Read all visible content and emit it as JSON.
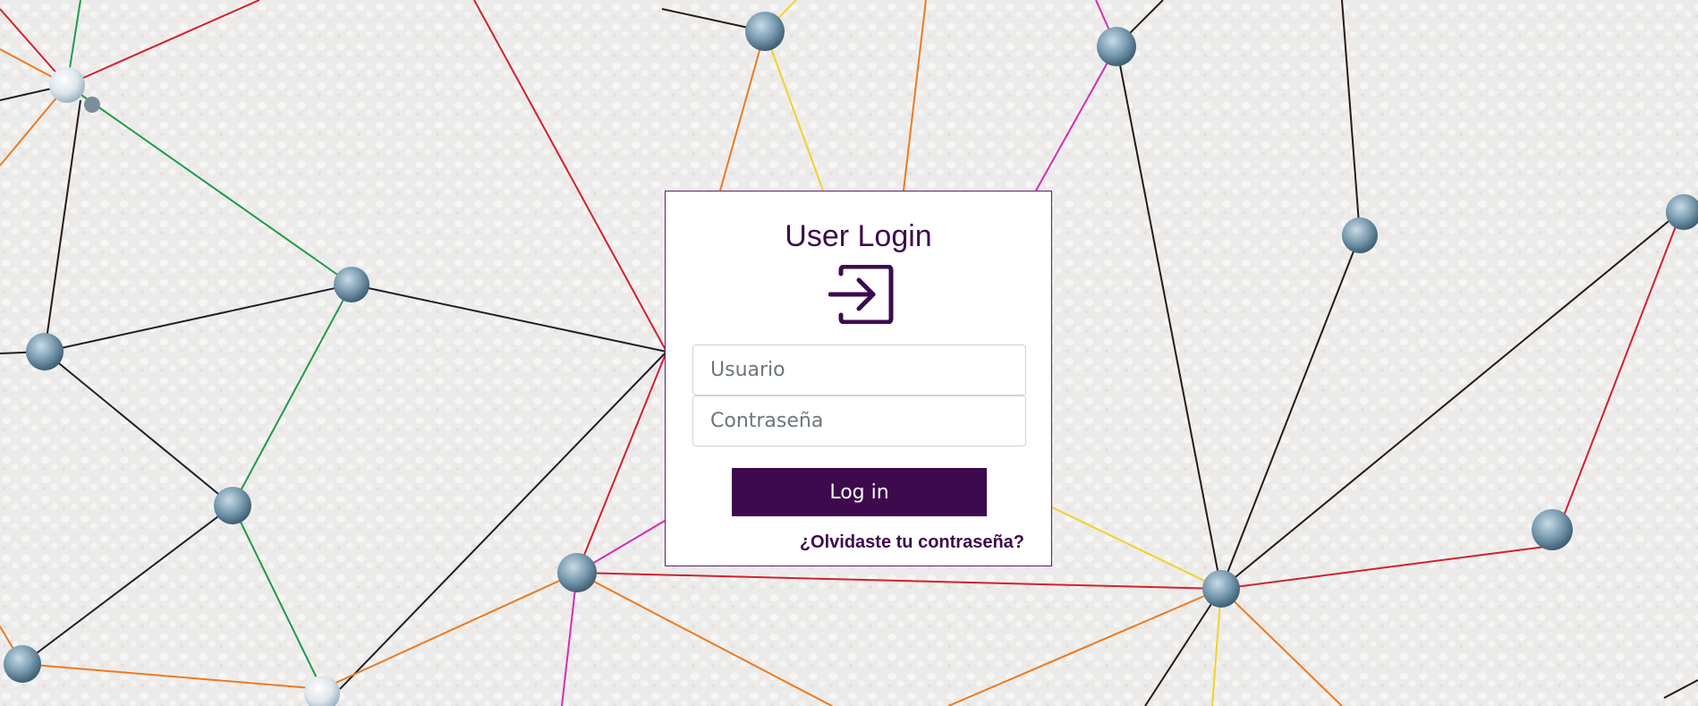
{
  "login": {
    "title": "User Login",
    "icon": "login-icon",
    "username_placeholder": "Usuario",
    "username_value": "",
    "password_placeholder": "Contraseña",
    "password_value": "",
    "submit_label": "Log in",
    "forgot_password_label": "¿Olvidaste tu contraseña?"
  },
  "colors": {
    "brand": "#3d0a4d",
    "card_background": "#ffffff",
    "page_background": "#ecebea"
  }
}
